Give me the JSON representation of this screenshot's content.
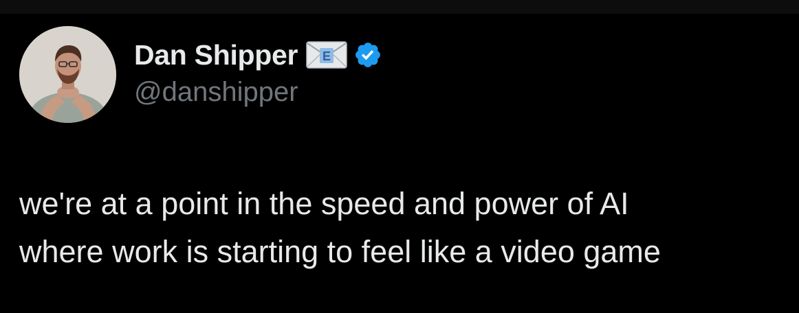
{
  "user": {
    "display_name": "Dan Shipper",
    "handle": "@danshipper",
    "name_badge_icon": "envelope-icon",
    "verified_icon": "verified-badge-icon",
    "verified_color": "#1d9bf0"
  },
  "tweet": {
    "lines": [
      "we're at a point in the speed and power of AI",
      "where work is starting to feel like a video game"
    ]
  },
  "colors": {
    "background": "#000000",
    "text_primary": "#e7e9ea",
    "text_secondary": "#71767b"
  }
}
